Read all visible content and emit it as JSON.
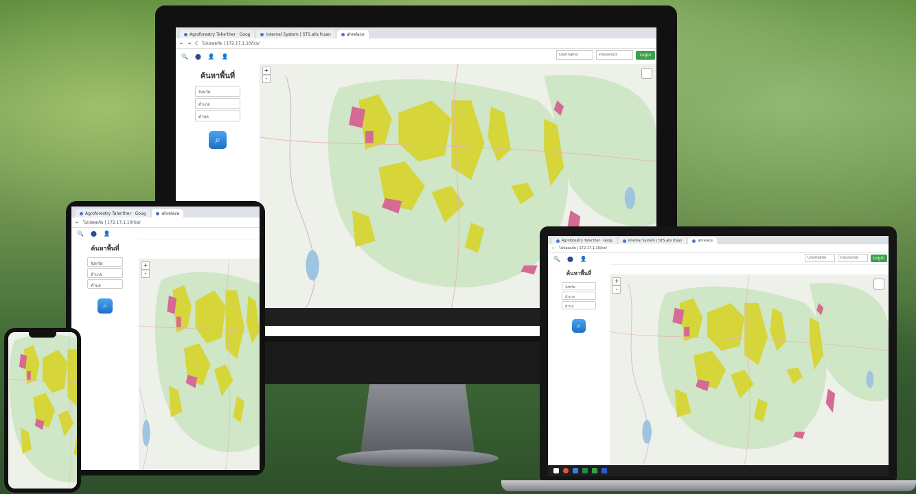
{
  "colors": {
    "accent": "#3aa24a",
    "forest": "#cfe6c7",
    "yellow": "#d6d53a",
    "pink": "#d56a94",
    "water": "#9ec4df"
  },
  "browser": {
    "tabs": [
      "Agroforestry Tahe'ther · Goog",
      "internal System | STS.alis fcsan",
      "ahrelace"
    ],
    "address": "ไม่ปลอดภัย | 172.17.1.10/lcs/"
  },
  "toolbar": {
    "icons": [
      "search-icon",
      "pin-icon",
      "user-icon",
      "user-icon"
    ],
    "username_placeholder": "Username",
    "password_placeholder": "Password",
    "login_label": "Login"
  },
  "sidebar": {
    "title": "ค้นหาพื้นที่",
    "fields": [
      "จังหวัด",
      "อำเภอ",
      "ตำบล"
    ]
  },
  "map": {
    "zoom_in": "+",
    "zoom_out": "-"
  }
}
